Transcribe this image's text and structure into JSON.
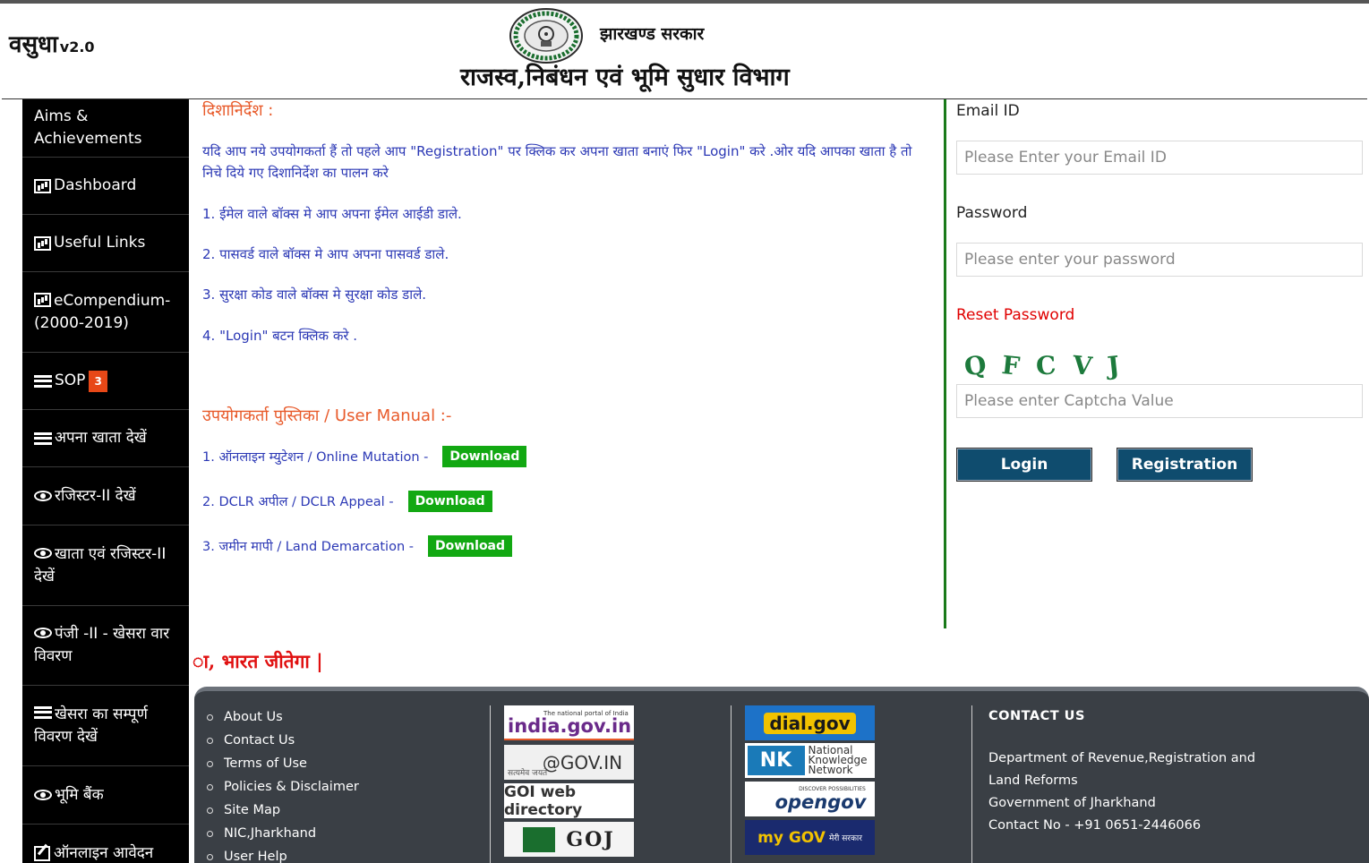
{
  "header": {
    "brand": "वसुधा",
    "version": "v2.0",
    "gov_name": "झारखण्ड सरकार",
    "dept_name": "राजस्व,निबंधन एवं भूमि सुधार विभाग"
  },
  "sidebar": {
    "items": [
      {
        "label": "Aims & Achievements",
        "icon": "none"
      },
      {
        "label": "Dashboard",
        "icon": "bar-chart-icon"
      },
      {
        "label": "Useful Links",
        "icon": "bar-chart-icon"
      },
      {
        "label": "eCompendium-(2000-2019)",
        "icon": "bar-chart-icon"
      },
      {
        "label": "SOP",
        "icon": "list-icon",
        "badge": "3"
      },
      {
        "label": "अपना खाता देखें",
        "icon": "list-icon"
      },
      {
        "label": "रजिस्टर-II देखें",
        "icon": "eye-icon"
      },
      {
        "label": "खाता एवं रजिस्टर-II देखें",
        "icon": "eye-icon"
      },
      {
        "label": "पंजी -II - खेसरा वार विवरण",
        "icon": "eye-icon"
      },
      {
        "label": "खेसरा का सम्पूर्ण विवरण देखें",
        "icon": "list-icon"
      },
      {
        "label": "भूमि बैंक",
        "icon": "eye-icon"
      },
      {
        "label": "ऑनलाइन आवेदन",
        "icon": "edit-icon"
      }
    ]
  },
  "guidelines": {
    "heading": "दिशानिर्देश :",
    "intro": "यदि आप नये उपयोगकर्ता हैं तो पहले आप \"Registration\" पर क्लिक कर अपना खाता बनाएं फिर \"Login\" करे .ओर यदि आपका खाता है तो निचे दिये गए दिशानिर्देश का पालन करे",
    "steps": [
      "1. ईमेल वाले बॉक्स मे आप अपना ईमेल आईडी डाले.",
      "2. पासवर्ड वाले बॉक्स मे आप अपना पासवर्ड डाले.",
      "3. सुरक्षा कोड वाले बॉक्स मे सुरक्षा कोड डाले.",
      "4. \"Login\" बटन क्लिक करे ."
    ]
  },
  "manual": {
    "heading": "उपयोगकर्ता पुस्तिका / User Manual :-",
    "items": [
      {
        "label": "1. ऑनलाइन म्युटेशन / Online Mutation -",
        "button": "Download"
      },
      {
        "label": "2. DCLR अपील / DCLR Appeal -",
        "button": "Download"
      },
      {
        "label": "3. जमीन मापी / Land Demarcation -",
        "button": "Download"
      }
    ]
  },
  "login": {
    "email_label": "Email ID",
    "email_placeholder": "Please Enter your Email ID",
    "password_label": "Password",
    "password_placeholder": "Please enter your password",
    "reset_link": "Reset Password",
    "captcha_chars": [
      "Q",
      "F",
      "C",
      "V",
      "J"
    ],
    "captcha_placeholder": "Please enter Captcha Value",
    "login_button": "Login",
    "registration_button": "Registration"
  },
  "ticker": "ा, भारत जीतेगा |",
  "footer": {
    "links": [
      "About Us",
      "Contact Us",
      "Terms of Use",
      "Policies & Disclaimer",
      "Site Map",
      "NIC,Jharkhand",
      "User Help"
    ],
    "logos_left": [
      {
        "name": "india-gov-logo",
        "line1": "The national portal of India",
        "text": "india.gov.in"
      },
      {
        "name": "at-gov-in-logo",
        "text": "@GOV.IN",
        "caption": "सत्यमेव जयते"
      },
      {
        "name": "goi-web-directory-logo",
        "text": "GOI web directory"
      },
      {
        "name": "goj-logo",
        "text": "GOJ"
      }
    ],
    "logos_right": [
      {
        "name": "dial-gov-logo",
        "text": "dial.gov"
      },
      {
        "name": "nkn-logo",
        "text": "National Knowledge Network"
      },
      {
        "name": "opengov-logo",
        "line1": "DISCOVER POSSIBILITIES",
        "text": "opengov"
      },
      {
        "name": "mygov-logo",
        "text": "my GOV",
        "caption": "मेरी सरकार"
      }
    ],
    "contact": {
      "title": "CONTACT US",
      "lines": [
        "Department of Revenue,Registration and Land Reforms",
        "Government of Jharkhand",
        "Contact No - +91 0651-2446066"
      ]
    }
  },
  "colors": {
    "sidebar_bg": "#000000",
    "accent_orange": "#e85a2a",
    "guide_text": "#2b38b5",
    "download_green": "#12a812",
    "button_blue": "#0f4c6e",
    "reset_red": "#e00000",
    "footer_bg": "#3a3f45"
  }
}
